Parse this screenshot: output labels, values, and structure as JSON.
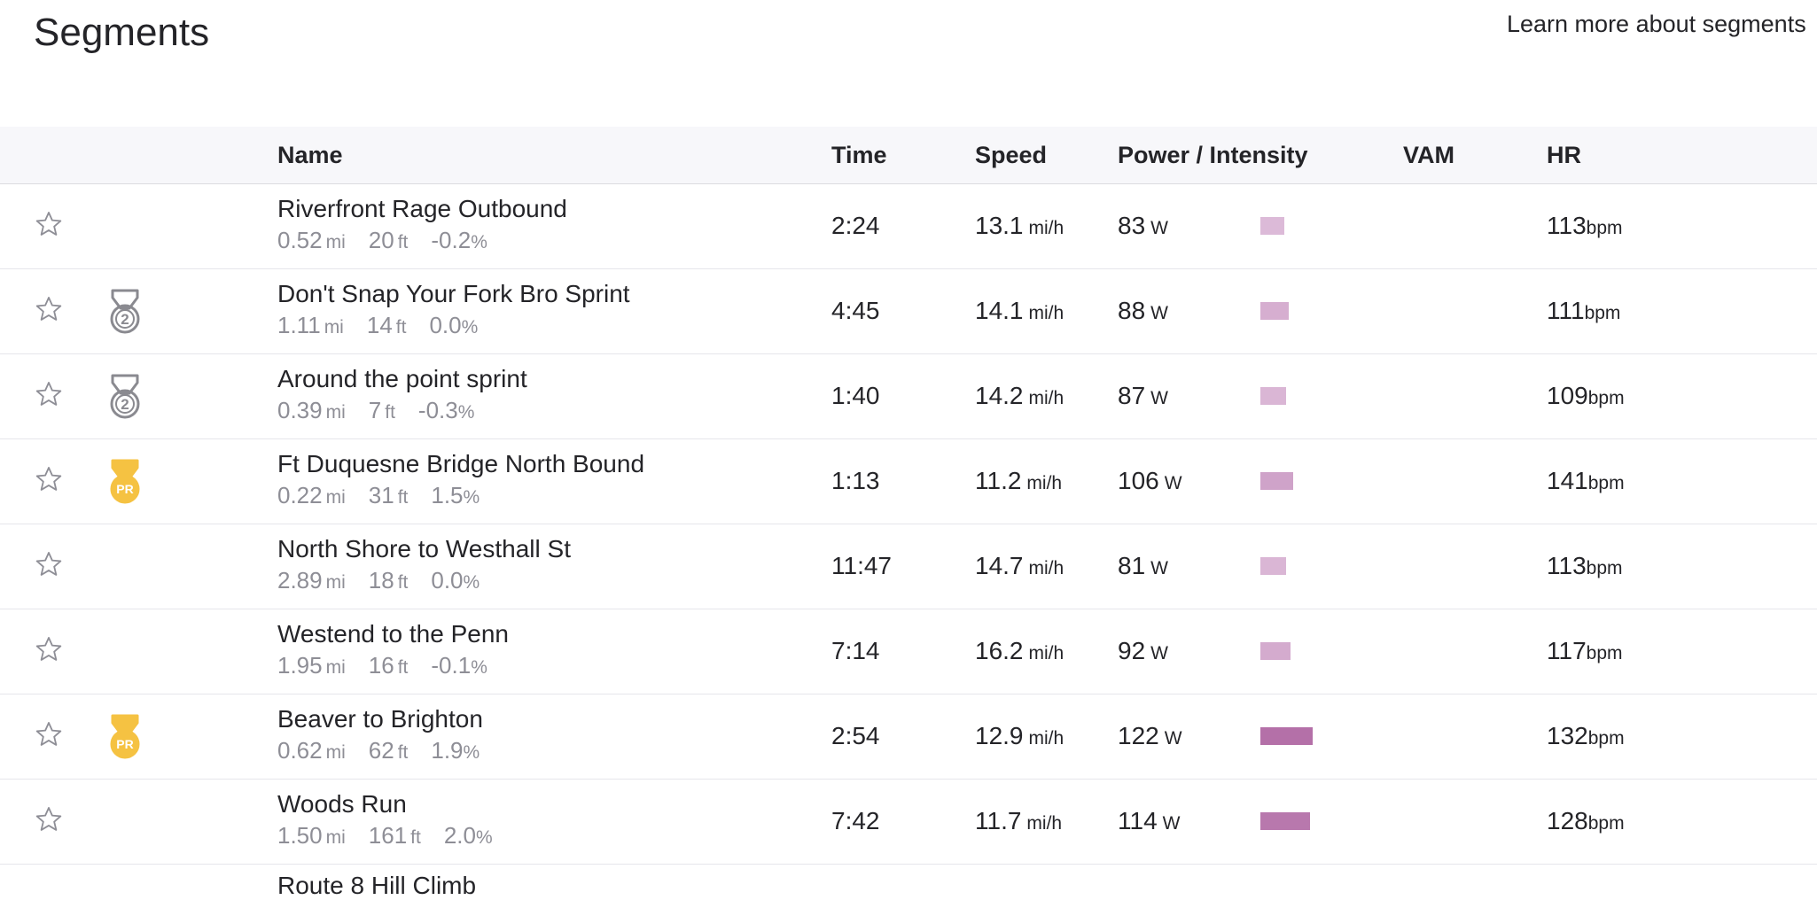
{
  "page": {
    "title": "Segments",
    "learn_more": "Learn more about segments"
  },
  "colors": {
    "intensity_bar": "#c89cc4",
    "medal_silver": "#8a8a90",
    "medal_pr": "#f5c242",
    "header_bg": "#f7f7fa"
  },
  "columns": {
    "name": "Name",
    "time": "Time",
    "speed": "Speed",
    "power": "Power / Intensity",
    "vam": "VAM",
    "hr": "HR"
  },
  "units": {
    "distance": "mi",
    "elevation": "ft",
    "grade": "%",
    "speed": "mi/h",
    "power": "W",
    "hr": "bpm"
  },
  "rows": [
    {
      "name": "Riverfront Rage Outbound",
      "distance": "0.52",
      "elevation": "20",
      "grade": "-0.2",
      "time": "2:24",
      "speed": "13.1",
      "power": "83",
      "intensity": 0.16,
      "vam": "",
      "hr": "113",
      "medal": ""
    },
    {
      "name": "Don't Snap Your Fork Bro Sprint",
      "distance": "1.11",
      "elevation": "14",
      "grade": "0.0",
      "time": "4:45",
      "speed": "14.1",
      "power": "88",
      "intensity": 0.19,
      "vam": "",
      "hr": "111",
      "medal": "2"
    },
    {
      "name": "Around the point sprint",
      "distance": "0.39",
      "elevation": "7",
      "grade": "-0.3",
      "time": "1:40",
      "speed": "14.2",
      "power": "87",
      "intensity": 0.17,
      "vam": "",
      "hr": "109",
      "medal": "2"
    },
    {
      "name": "Ft Duquesne Bridge North Bound",
      "distance": "0.22",
      "elevation": "31",
      "grade": "1.5",
      "time": "1:13",
      "speed": "11.2",
      "power": "106",
      "intensity": 0.22,
      "vam": "",
      "hr": "141",
      "medal": "PR"
    },
    {
      "name": "North Shore to Westhall St",
      "distance": "2.89",
      "elevation": "18",
      "grade": "0.0",
      "time": "11:47",
      "speed": "14.7",
      "power": "81",
      "intensity": 0.17,
      "vam": "",
      "hr": "113",
      "medal": ""
    },
    {
      "name": "Westend to the Penn",
      "distance": "1.95",
      "elevation": "16",
      "grade": "-0.1",
      "time": "7:14",
      "speed": "16.2",
      "power": "92",
      "intensity": 0.2,
      "vam": "",
      "hr": "117",
      "medal": ""
    },
    {
      "name": "Beaver to Brighton",
      "distance": "0.62",
      "elevation": "62",
      "grade": "1.9",
      "time": "2:54",
      "speed": "12.9",
      "power": "122",
      "intensity": 0.35,
      "vam": "",
      "hr": "132",
      "medal": "PR"
    },
    {
      "name": "Woods Run",
      "distance": "1.50",
      "elevation": "161",
      "grade": "2.0",
      "time": "7:42",
      "speed": "11.7",
      "power": "114",
      "intensity": 0.33,
      "vam": "",
      "hr": "128",
      "medal": ""
    }
  ],
  "clipped_row": {
    "name": "Route 8 Hill Climb"
  }
}
